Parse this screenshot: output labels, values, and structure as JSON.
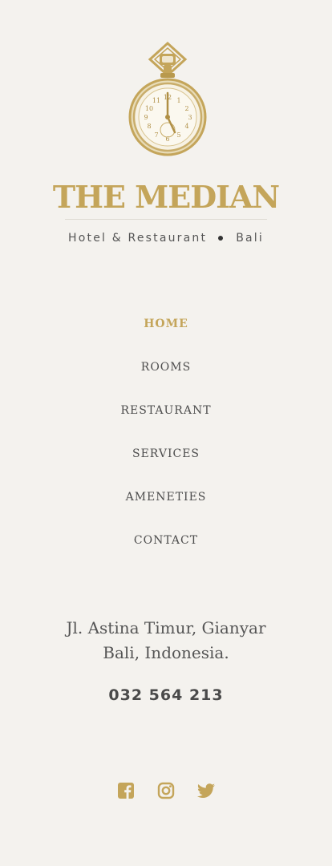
{
  "brand": {
    "title": "THE MEDIAN",
    "tagline_left": "Hotel & Restaurant",
    "tagline_right": "Bali",
    "logo_icon": "pocket-watch-icon",
    "accent_color": "#c4a55a"
  },
  "nav": {
    "items": [
      {
        "label": "HOME",
        "active": true
      },
      {
        "label": "ROOMS",
        "active": false
      },
      {
        "label": "RESTAURANT",
        "active": false
      },
      {
        "label": "SERVICES",
        "active": false
      },
      {
        "label": "AMENETIES",
        "active": false
      },
      {
        "label": "CONTACT",
        "active": false
      }
    ]
  },
  "contact": {
    "address_line1": "Jl. Astina Timur, Gianyar",
    "address_line2": "Bali, Indonesia.",
    "phone": "032 564 213"
  },
  "social": {
    "icons": [
      "facebook-icon",
      "instagram-icon",
      "twitter-icon"
    ]
  }
}
